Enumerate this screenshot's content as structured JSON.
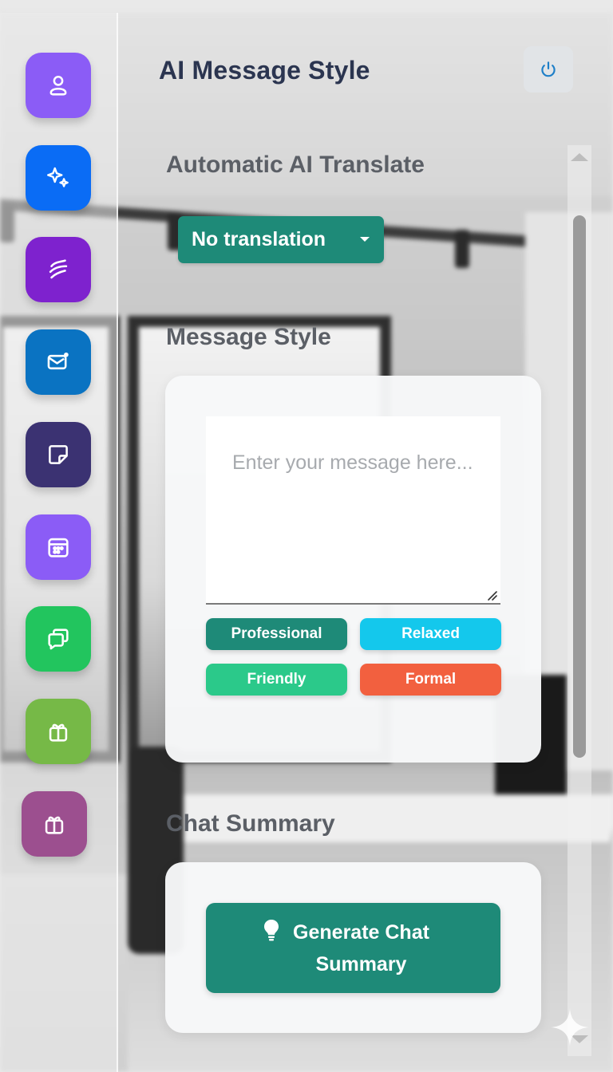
{
  "header": {
    "title": "AI Message Style"
  },
  "sidebar": {
    "items": [
      {
        "icon": "user-icon",
        "color": "#8b5cf6"
      },
      {
        "icon": "sparkles-icon",
        "color": "#0a6cf5"
      },
      {
        "icon": "wave-icon",
        "color": "#7e22ce"
      },
      {
        "icon": "mail-notification-icon",
        "color": "#0a73c2"
      },
      {
        "icon": "sticky-note-icon",
        "color": "#3b3272"
      },
      {
        "icon": "calendar-icon",
        "color": "#8b5cf6"
      },
      {
        "icon": "chat-bubbles-icon",
        "color": "#22c55e"
      },
      {
        "icon": "gift-icon",
        "color": "#76b947"
      },
      {
        "icon": "gift-icon",
        "color": "#9c4f8f"
      }
    ]
  },
  "translate": {
    "label": "Automatic AI Translate",
    "selected": "No translation"
  },
  "message_style": {
    "label": "Message Style",
    "placeholder": "Enter your message here...",
    "buttons": {
      "professional": "Professional",
      "relaxed": "Relaxed",
      "friendly": "Friendly",
      "formal": "Formal"
    },
    "colors": {
      "professional": "#1e8a78",
      "relaxed": "#14c8ec",
      "friendly": "#2bc98a",
      "formal": "#f2603f"
    }
  },
  "chat_summary": {
    "label": "Chat Summary",
    "button": "Generate Chat Summary"
  },
  "colors": {
    "accent": "#1e8a78",
    "title": "#2b3550"
  }
}
